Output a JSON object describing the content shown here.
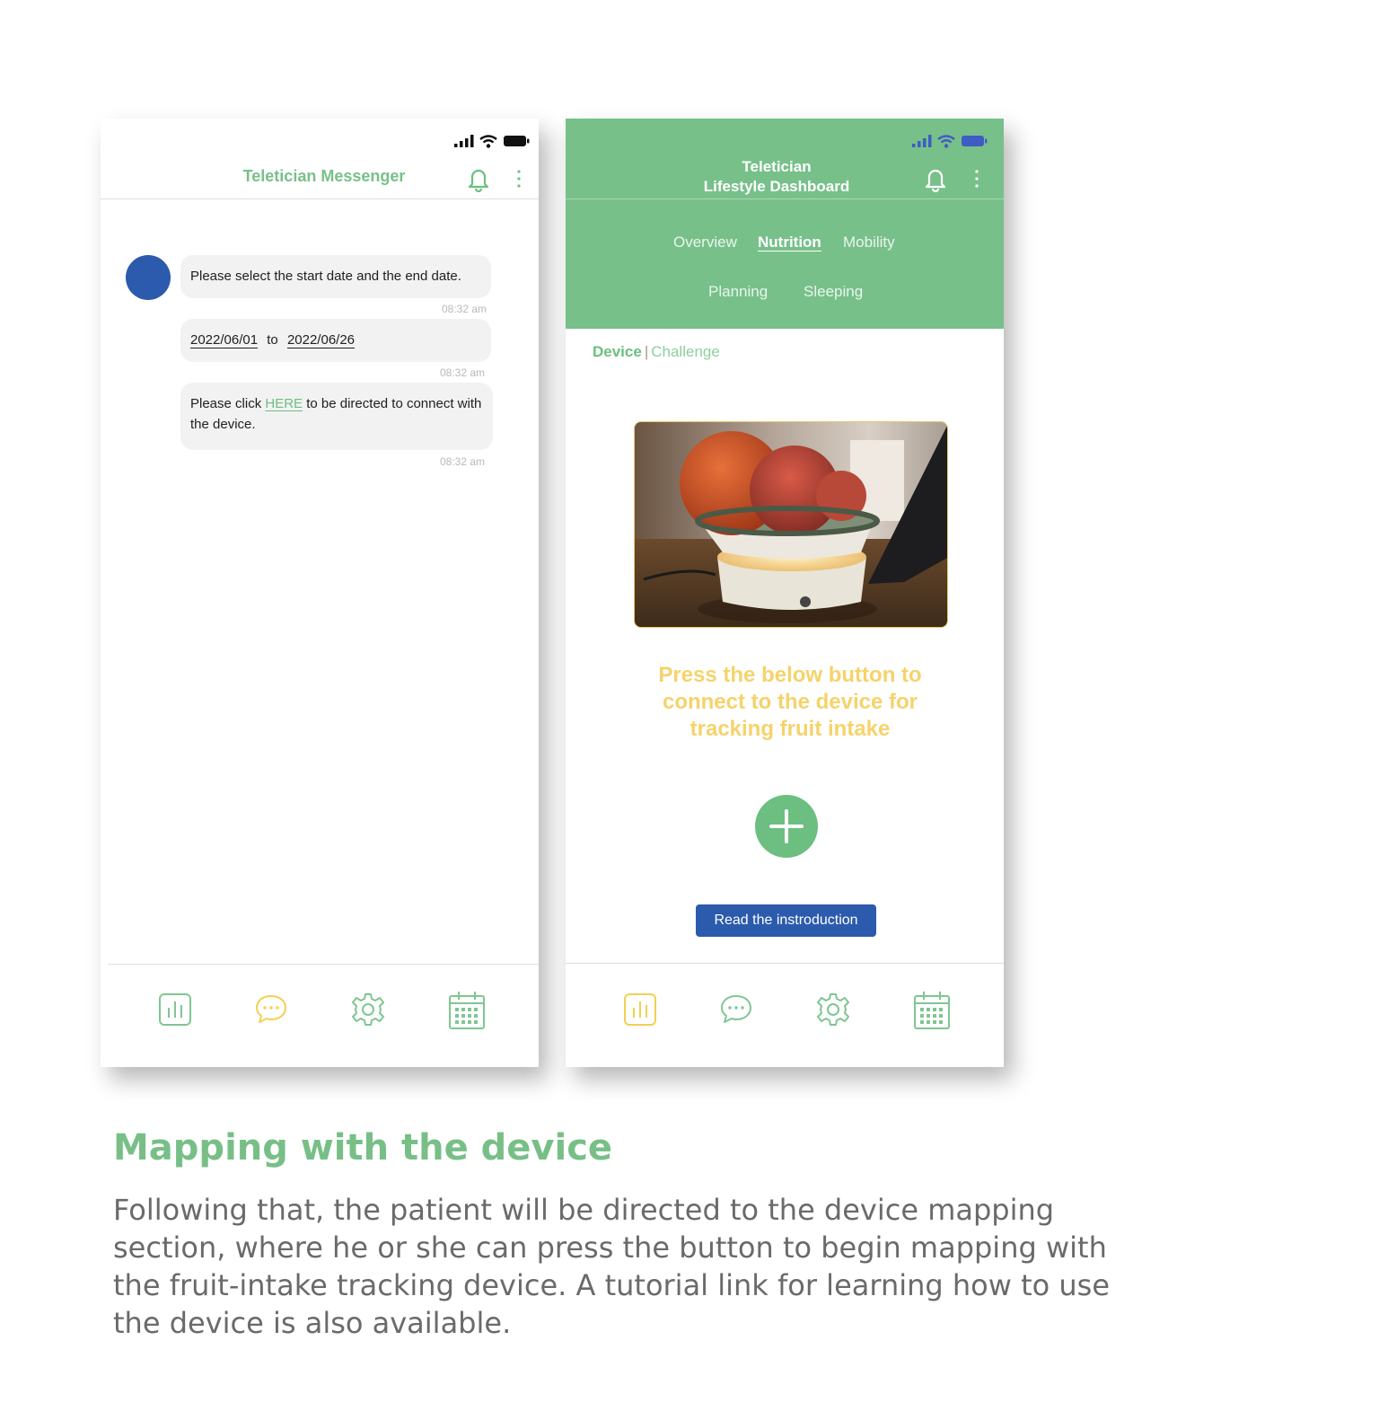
{
  "left_phone": {
    "title": "Teletician Messenger",
    "messages": [
      {
        "text": "Please select the start date and the end date.",
        "time": "08:32 am"
      },
      {
        "start_date": "2022/06/01",
        "connector": "to",
        "end_date": "2022/06/26",
        "time": "08:32 am"
      },
      {
        "text_before": "Please click ",
        "link": "HERE",
        "text_after": " to be directed to connect with the device.",
        "time": "08:32 am"
      }
    ],
    "tabbar_icons": [
      "chart-icon",
      "chat-icon",
      "settings-icon",
      "calendar-icon"
    ]
  },
  "right_phone": {
    "title_line1": "Teletician",
    "title_line2": "Lifestyle Dashboard",
    "nav_tabs": [
      "Overview",
      "Nutrition",
      "Mobility",
      "Planning",
      "Sleeping"
    ],
    "active_tab": "Nutrition",
    "sub_tabs": {
      "active": "Device",
      "separator": "|",
      "inactive": "Challenge"
    },
    "prompt": "Press the below button to connect to the device for tracking fruit intake",
    "intro_button": "Read the instroduction",
    "tabbar_icons": [
      "chart-icon",
      "chat-icon",
      "settings-icon",
      "calendar-icon"
    ]
  },
  "caption": {
    "title": "Mapping with the device",
    "body": "Following that, the patient will be directed to the device mapping section, where he or she can press the button to begin mapping with the fruit-intake tracking device. A tutorial link for learning how to use the device is also available."
  },
  "colors": {
    "brand_green": "#78c08a",
    "accent_blue": "#2c5aad",
    "prompt_yellow": "#f5d36b"
  }
}
